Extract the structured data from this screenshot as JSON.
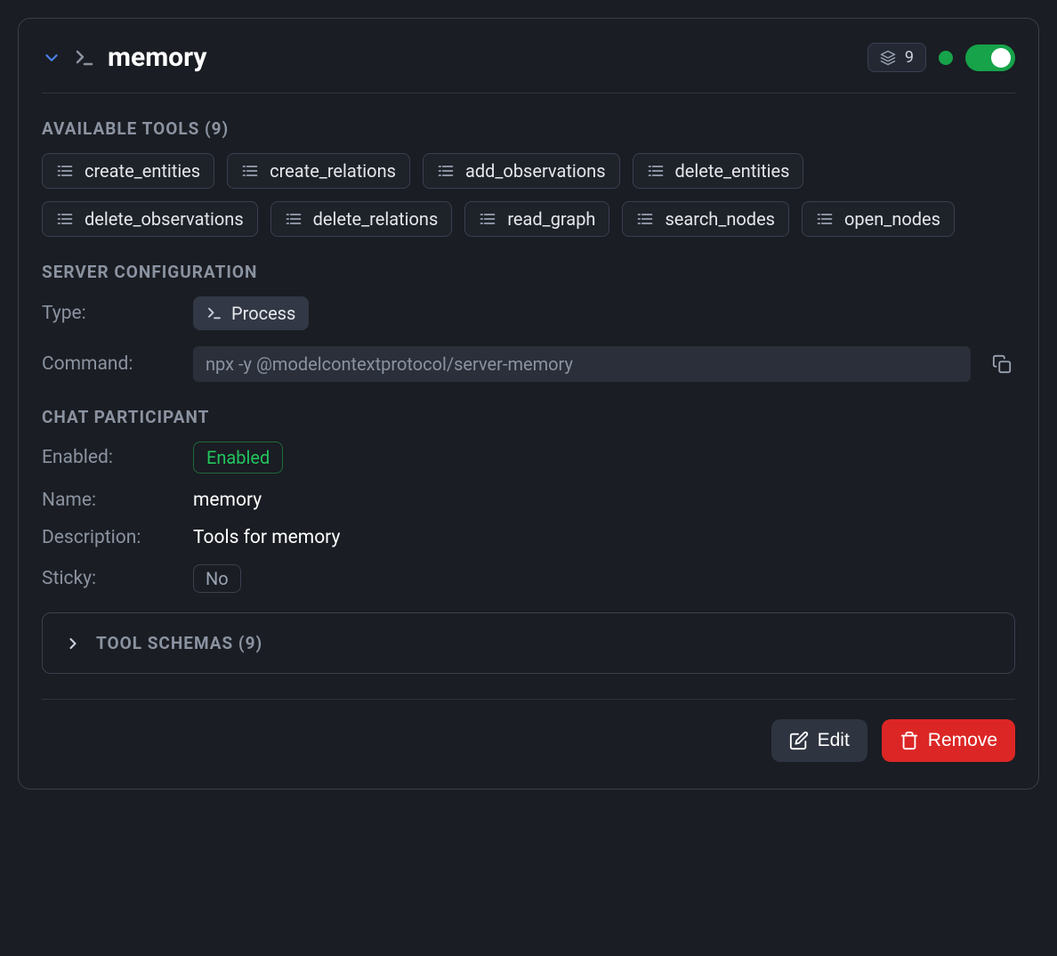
{
  "header": {
    "title": "memory",
    "tool_count": "9"
  },
  "sections": {
    "available_tools_label": "AVAILABLE TOOLS (9)",
    "server_config_label": "SERVER CONFIGURATION",
    "chat_participant_label": "CHAT PARTICIPANT",
    "tool_schemas_label": "TOOL SCHEMAS (9)"
  },
  "tools": [
    "create_entities",
    "create_relations",
    "add_observations",
    "delete_entities",
    "delete_observations",
    "delete_relations",
    "read_graph",
    "search_nodes",
    "open_nodes"
  ],
  "config": {
    "type_label": "Type:",
    "type_value": "Process",
    "command_label": "Command:",
    "command_value": "npx -y @modelcontextprotocol/server-memory"
  },
  "participant": {
    "enabled_label": "Enabled:",
    "enabled_value": "Enabled",
    "name_label": "Name:",
    "name_value": "memory",
    "description_label": "Description:",
    "description_value": "Tools for memory",
    "sticky_label": "Sticky:",
    "sticky_value": "No"
  },
  "buttons": {
    "edit": "Edit",
    "remove": "Remove"
  }
}
